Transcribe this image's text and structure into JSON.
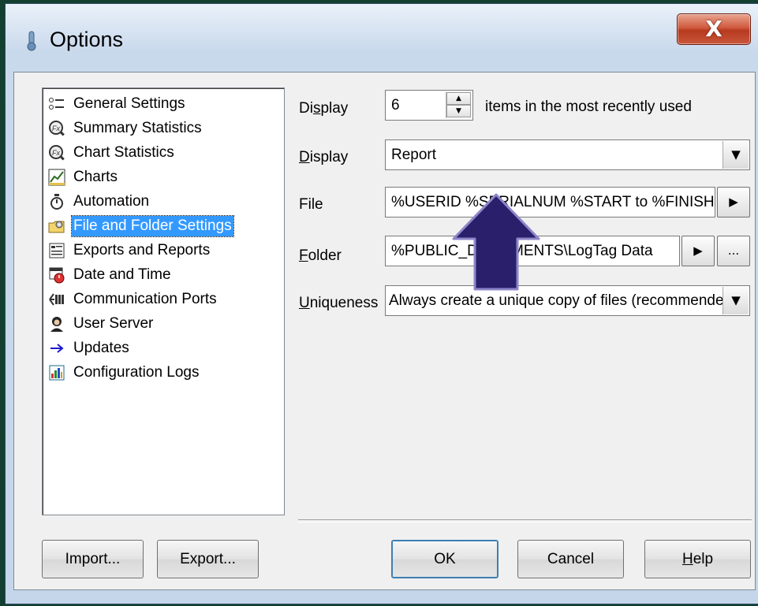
{
  "window": {
    "title": "Options",
    "close_glyph": "X",
    "title_icon": "thermometer-icon"
  },
  "tree": {
    "items": [
      {
        "label": "General Settings",
        "icon": "list-settings-icon",
        "selected": false
      },
      {
        "label": "Summary Statistics",
        "icon": "statistics-icon",
        "selected": false
      },
      {
        "label": "Chart Statistics",
        "icon": "statistics-icon",
        "selected": false
      },
      {
        "label": "Charts",
        "icon": "line-chart-icon",
        "selected": false
      },
      {
        "label": "Automation",
        "icon": "stopwatch-icon",
        "selected": false
      },
      {
        "label": "File and Folder Settings",
        "icon": "folder-settings-icon",
        "selected": true
      },
      {
        "label": "Exports and Reports",
        "icon": "report-icon",
        "selected": false
      },
      {
        "label": "Date and Time",
        "icon": "calendar-clock-icon",
        "selected": false
      },
      {
        "label": "Communication Ports",
        "icon": "port-icon",
        "selected": false
      },
      {
        "label": "User Server",
        "icon": "user-server-icon",
        "selected": false
      },
      {
        "label": "Updates",
        "icon": "arrow-right-icon",
        "selected": false
      },
      {
        "label": "Configuration Logs",
        "icon": "log-icon",
        "selected": false
      }
    ]
  },
  "settings": {
    "mru": {
      "label_pre": "Di",
      "label_accel": "s",
      "label_post": "play",
      "value": "6",
      "suffix": "items in the most recently used"
    },
    "display": {
      "label_accel": "D",
      "label_post": "isplay",
      "value": "Report"
    },
    "file": {
      "label": "File",
      "value": "%USERID %SERIALNUM %START to %FINISH"
    },
    "folder": {
      "label_accel": "F",
      "label_post": "older",
      "value": "%PUBLIC_DOCUMENTS\\LogTag Data",
      "browse_label": "..."
    },
    "uniqueness": {
      "label_accel": "U",
      "label_post": "niqueness",
      "value": "Always create a unique copy of files (recommended)"
    }
  },
  "buttons": {
    "import": "Import...",
    "export": "Export...",
    "ok": "OK",
    "cancel": "Cancel",
    "help_accel": "H",
    "help_post": "elp"
  },
  "colors": {
    "selection": "#3399ff",
    "annotation_arrow": "#2a1f6b",
    "close_button": "#c9483a",
    "background": "#123f30"
  }
}
